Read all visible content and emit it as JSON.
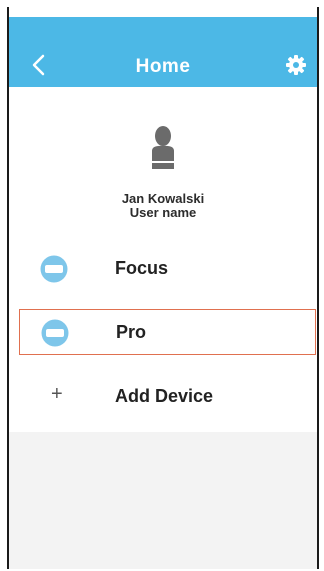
{
  "header": {
    "title": "Home",
    "color": "#4cb8e6",
    "back_icon": "chevron-left-icon",
    "settings_icon": "gear-icon"
  },
  "profile": {
    "avatar_icon": "user-silhouette-icon",
    "name": "Jan Kowalski",
    "subtitle": "User name"
  },
  "devices": [
    {
      "label": "Focus",
      "icon": "device-icon",
      "selected": false
    },
    {
      "label": "Pro",
      "icon": "device-icon",
      "selected": true
    }
  ],
  "add_device": {
    "label": "Add Device",
    "icon": "plus-icon"
  },
  "colors": {
    "selection_border": "#e0704f",
    "device_icon": "#7ec6ea"
  }
}
